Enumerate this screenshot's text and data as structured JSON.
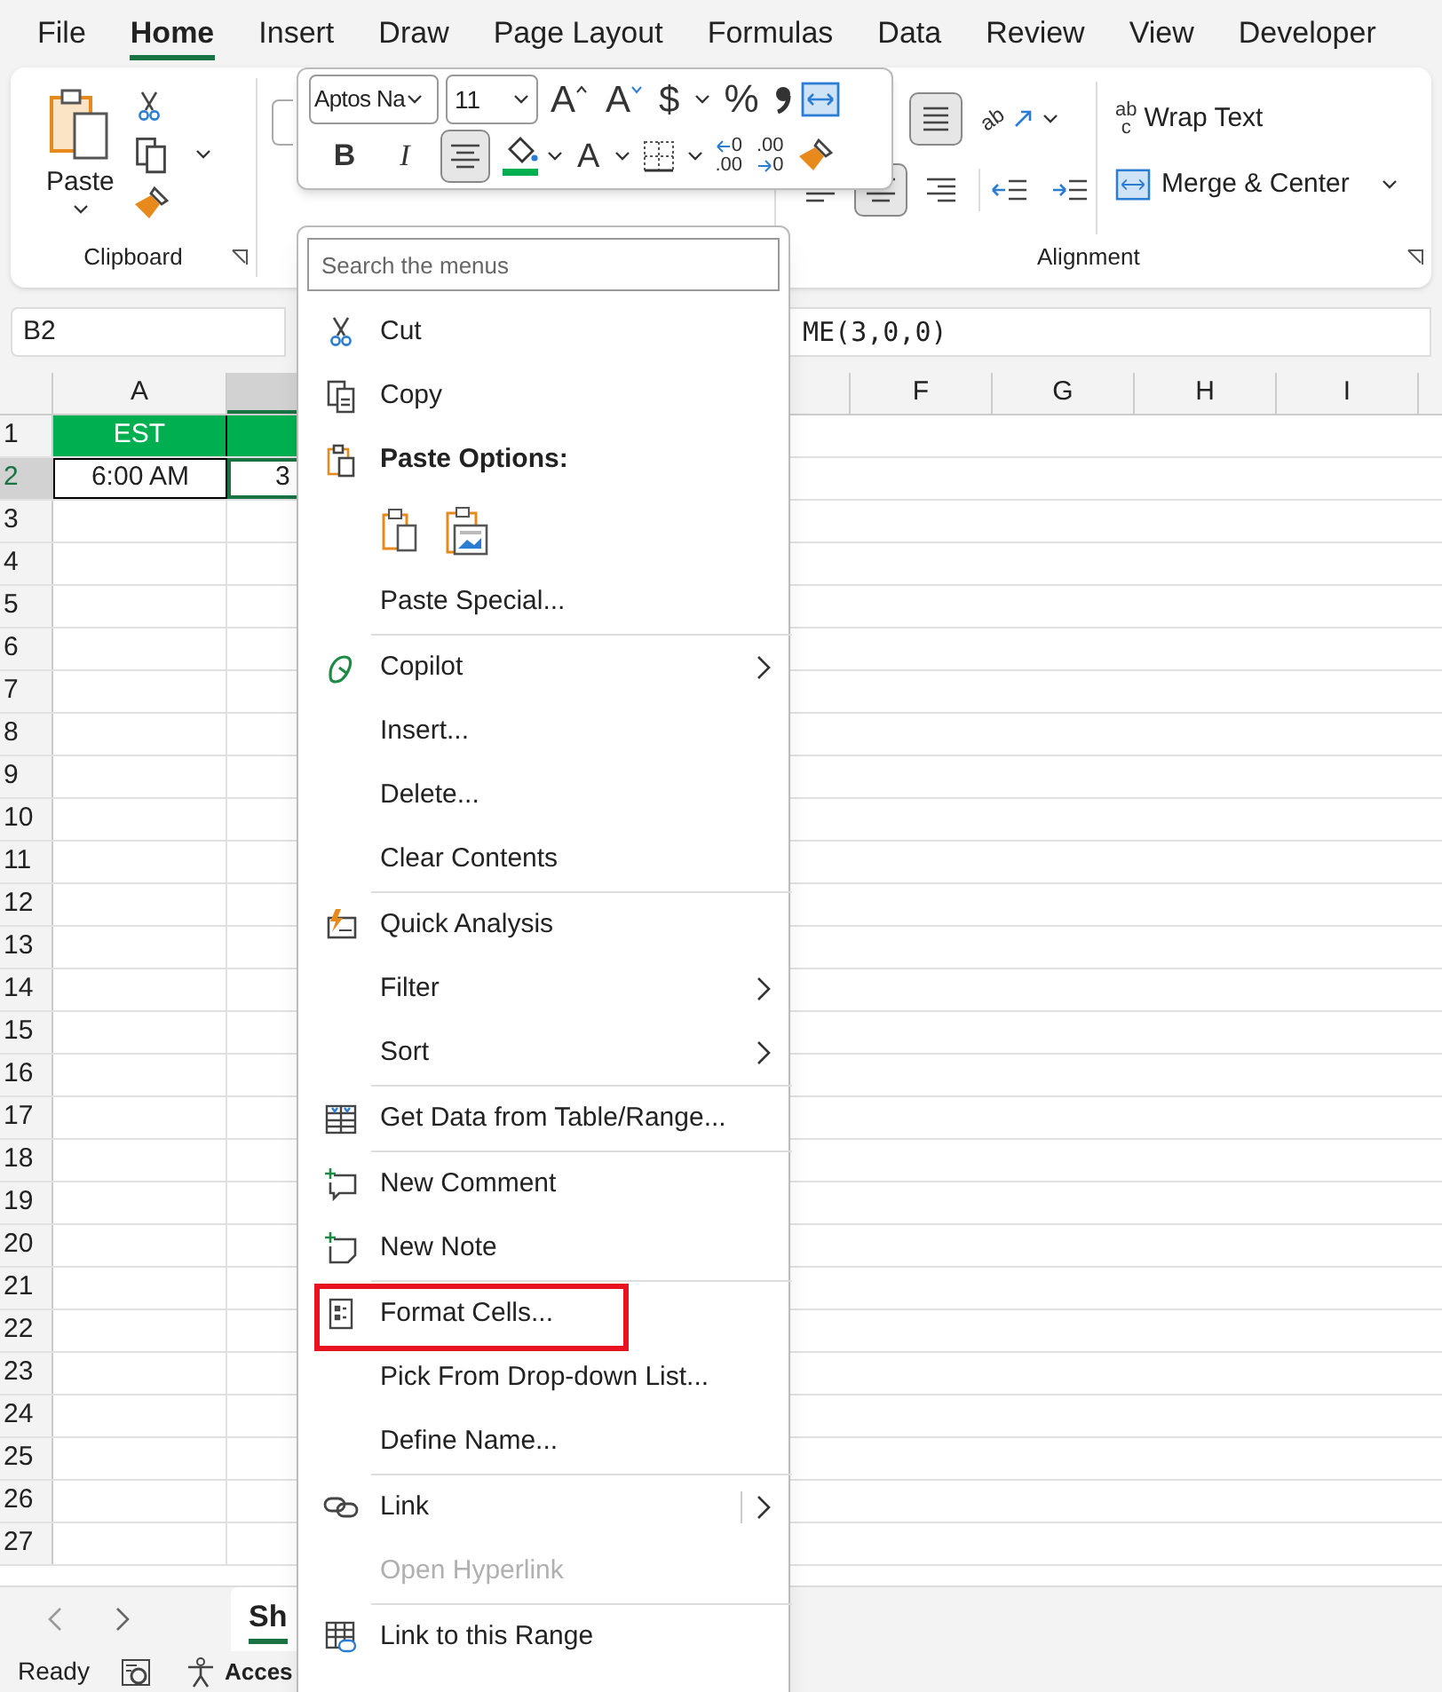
{
  "tabs": [
    {
      "label": "File",
      "selected": false
    },
    {
      "label": "Home",
      "selected": true
    },
    {
      "label": "Insert",
      "selected": false
    },
    {
      "label": "Draw",
      "selected": false
    },
    {
      "label": "Page Layout",
      "selected": false
    },
    {
      "label": "Formulas",
      "selected": false
    },
    {
      "label": "Data",
      "selected": false
    },
    {
      "label": "Review",
      "selected": false
    },
    {
      "label": "View",
      "selected": false
    },
    {
      "label": "Developer",
      "selected": false
    }
  ],
  "clipboard": {
    "paste": "Paste",
    "label": "Clipboard"
  },
  "alignment": {
    "label": "Alignment",
    "orientation_glyph": "ab",
    "wrap_glyph": [
      "ab",
      "c"
    ],
    "wrap_text": "Wrap Text",
    "merge": "Merge & Center",
    "top_row": [
      {
        "selected": true
      }
    ],
    "bottom_row": [
      {
        "selected": false
      },
      {
        "selected": true
      },
      {
        "selected": false
      }
    ]
  },
  "formula_bar": {
    "name_box": "B2",
    "formula": "ME(3,0,0)"
  },
  "sheet": {
    "columns": [
      "A",
      "F",
      "G",
      "H",
      "I"
    ],
    "rows": [
      "1",
      "2",
      "3",
      "4",
      "5",
      "6",
      "7",
      "8",
      "9",
      "10",
      "11",
      "12",
      "13",
      "14",
      "15",
      "16",
      "17",
      "18",
      "19",
      "20",
      "21",
      "22",
      "23",
      "24",
      "25",
      "26",
      "27"
    ],
    "header_cell": {
      "text": "EST",
      "color": "#00b050"
    },
    "value_cell": "6:00 AM",
    "selected_cell": "3"
  },
  "sheet_tab": "Sh",
  "status_bar": {
    "state": "Ready",
    "accessibility": "Acces"
  },
  "mini_toolbar": {
    "row1": [
      {
        "kind": "font",
        "value": "Aptos Na"
      },
      {
        "kind": "size",
        "value": "11"
      },
      {
        "kind": "grow",
        "label": "A"
      },
      {
        "kind": "shrink",
        "label": "A"
      },
      {
        "kind": "currency",
        "label": "$"
      },
      {
        "kind": "percent",
        "label": "%"
      },
      {
        "kind": "comma"
      },
      {
        "kind": "merge"
      }
    ],
    "row2": [
      {
        "kind": "bold",
        "label": "B",
        "selected": false
      },
      {
        "kind": "italic",
        "label": "I",
        "selected": false
      },
      {
        "kind": "center",
        "selected": true
      },
      {
        "kind": "fill",
        "color": "#00b050"
      },
      {
        "kind": "font_color",
        "label": "A"
      },
      {
        "kind": "borders"
      },
      {
        "kind": "decimal_more",
        "lines": [
          "0",
          ".00"
        ]
      },
      {
        "kind": "decimal_less",
        "lines": [
          ".00",
          "0"
        ]
      },
      {
        "kind": "painter"
      }
    ]
  },
  "context_menu": {
    "search_placeholder": "Search the menus",
    "groups": [
      [
        {
          "kind": "item",
          "label": "Cut",
          "submenu": false,
          "disabled": false,
          "marked": false
        },
        {
          "kind": "item",
          "label": "Copy",
          "submenu": false,
          "disabled": false,
          "marked": false
        },
        {
          "kind": "heading",
          "label": "Paste Options:"
        },
        {
          "kind": "paste_icons"
        },
        {
          "kind": "item",
          "label": "Paste Special...",
          "submenu": false,
          "disabled": false,
          "marked": false
        }
      ],
      [
        {
          "kind": "item",
          "label": "Copilot",
          "submenu": true,
          "disabled": false,
          "marked": false
        },
        {
          "kind": "item",
          "label": "Insert...",
          "submenu": false,
          "disabled": false,
          "marked": false
        },
        {
          "kind": "item",
          "label": "Delete...",
          "submenu": false,
          "disabled": false,
          "marked": false
        },
        {
          "kind": "item",
          "label": "Clear Contents",
          "submenu": false,
          "disabled": false,
          "marked": false
        }
      ],
      [
        {
          "kind": "item",
          "label": "Quick Analysis",
          "submenu": false,
          "disabled": false,
          "marked": false
        },
        {
          "kind": "item",
          "label": "Filter",
          "submenu": true,
          "disabled": false,
          "marked": false
        },
        {
          "kind": "item",
          "label": "Sort",
          "submenu": true,
          "disabled": false,
          "marked": false
        }
      ],
      [
        {
          "kind": "item",
          "label": "Get Data from Table/Range...",
          "submenu": false,
          "disabled": false,
          "marked": false
        }
      ],
      [
        {
          "kind": "item",
          "label": "New Comment",
          "submenu": false,
          "disabled": false,
          "marked": false
        },
        {
          "kind": "item",
          "label": "New Note",
          "submenu": false,
          "disabled": false,
          "marked": false
        }
      ],
      [
        {
          "kind": "item",
          "label": "Format Cells...",
          "submenu": false,
          "disabled": false,
          "marked": true
        },
        {
          "kind": "item",
          "label": "Pick From Drop-down List...",
          "submenu": false,
          "disabled": false,
          "marked": false
        },
        {
          "kind": "item",
          "label": "Define Name...",
          "submenu": false,
          "disabled": false,
          "marked": false
        }
      ],
      [
        {
          "kind": "item",
          "label": "Link",
          "submenu": true,
          "disabled": false,
          "marked": false
        },
        {
          "kind": "item",
          "label": "Open Hyperlink",
          "submenu": false,
          "disabled": true,
          "marked": false
        }
      ],
      [
        {
          "kind": "item",
          "label": "Link to this Range",
          "submenu": false,
          "disabled": false,
          "marked": false
        }
      ]
    ]
  }
}
